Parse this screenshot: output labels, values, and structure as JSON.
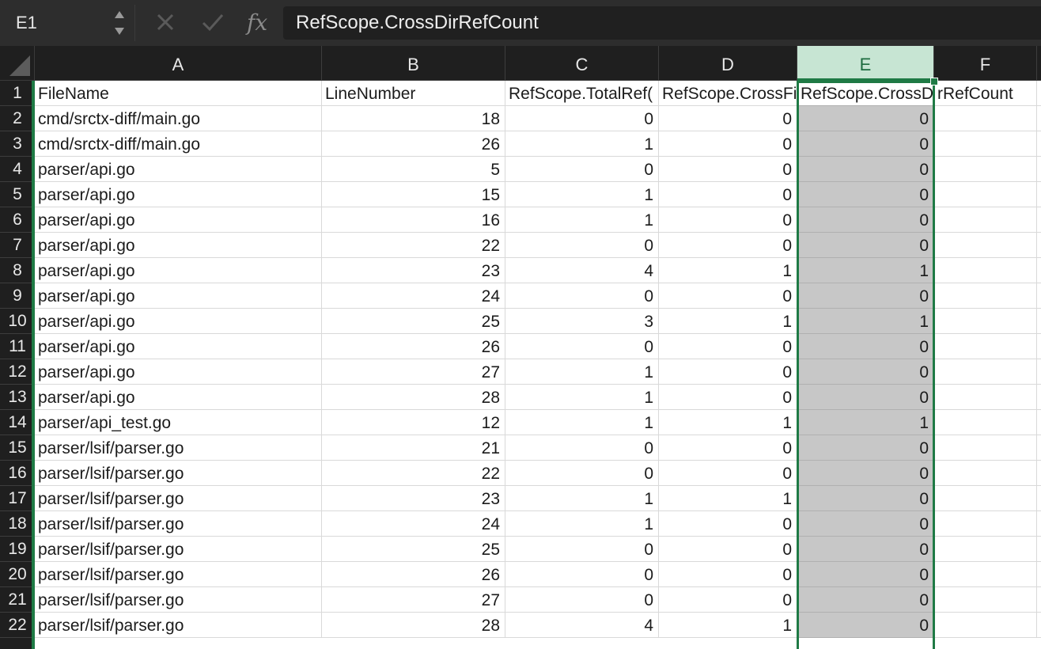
{
  "formula_bar": {
    "name_box": "E1",
    "formula": "RefScope.CrossDirRefCount",
    "cancel_icon": "close-icon",
    "enter_icon": "check-icon",
    "function_icon": "fx"
  },
  "grid": {
    "columns": [
      "A",
      "B",
      "C",
      "D",
      "E",
      "F"
    ],
    "selected_column": "E",
    "header_row": [
      "FileName",
      "LineNumber",
      "RefScope.TotalRef(",
      "RefScope.CrossFi",
      "RefScope.CrossDi",
      "rRefCount"
    ],
    "rows": [
      {
        "n": "1"
      },
      {
        "n": "2",
        "a": "cmd/srctx-diff/main.go",
        "b": "18",
        "c": "0",
        "d": "0",
        "e": "0"
      },
      {
        "n": "3",
        "a": "cmd/srctx-diff/main.go",
        "b": "26",
        "c": "1",
        "d": "0",
        "e": "0"
      },
      {
        "n": "4",
        "a": "parser/api.go",
        "b": "5",
        "c": "0",
        "d": "0",
        "e": "0"
      },
      {
        "n": "5",
        "a": "parser/api.go",
        "b": "15",
        "c": "1",
        "d": "0",
        "e": "0"
      },
      {
        "n": "6",
        "a": "parser/api.go",
        "b": "16",
        "c": "1",
        "d": "0",
        "e": "0"
      },
      {
        "n": "7",
        "a": "parser/api.go",
        "b": "22",
        "c": "0",
        "d": "0",
        "e": "0"
      },
      {
        "n": "8",
        "a": "parser/api.go",
        "b": "23",
        "c": "4",
        "d": "1",
        "e": "1"
      },
      {
        "n": "9",
        "a": "parser/api.go",
        "b": "24",
        "c": "0",
        "d": "0",
        "e": "0"
      },
      {
        "n": "10",
        "a": "parser/api.go",
        "b": "25",
        "c": "3",
        "d": "1",
        "e": "1"
      },
      {
        "n": "11",
        "a": "parser/api.go",
        "b": "26",
        "c": "0",
        "d": "0",
        "e": "0"
      },
      {
        "n": "12",
        "a": "parser/api.go",
        "b": "27",
        "c": "1",
        "d": "0",
        "e": "0"
      },
      {
        "n": "13",
        "a": "parser/api.go",
        "b": "28",
        "c": "1",
        "d": "0",
        "e": "0"
      },
      {
        "n": "14",
        "a": "parser/api_test.go",
        "b": "12",
        "c": "1",
        "d": "1",
        "e": "1"
      },
      {
        "n": "15",
        "a": "parser/lsif/parser.go",
        "b": "21",
        "c": "0",
        "d": "0",
        "e": "0"
      },
      {
        "n": "16",
        "a": "parser/lsif/parser.go",
        "b": "22",
        "c": "0",
        "d": "0",
        "e": "0"
      },
      {
        "n": "17",
        "a": "parser/lsif/parser.go",
        "b": "23",
        "c": "1",
        "d": "1",
        "e": "0"
      },
      {
        "n": "18",
        "a": "parser/lsif/parser.go",
        "b": "24",
        "c": "1",
        "d": "0",
        "e": "0"
      },
      {
        "n": "19",
        "a": "parser/lsif/parser.go",
        "b": "25",
        "c": "0",
        "d": "0",
        "e": "0"
      },
      {
        "n": "20",
        "a": "parser/lsif/parser.go",
        "b": "26",
        "c": "0",
        "d": "0",
        "e": "0"
      },
      {
        "n": "21",
        "a": "parser/lsif/parser.go",
        "b": "27",
        "c": "0",
        "d": "0",
        "e": "0"
      },
      {
        "n": "22",
        "a": "parser/lsif/parser.go",
        "b": "28",
        "c": "4",
        "d": "1",
        "e": "0"
      }
    ]
  },
  "colors": {
    "accent": "#1f7a45",
    "selected_fill": "#c7c7c7",
    "selected_header": "#c7e5d3"
  }
}
